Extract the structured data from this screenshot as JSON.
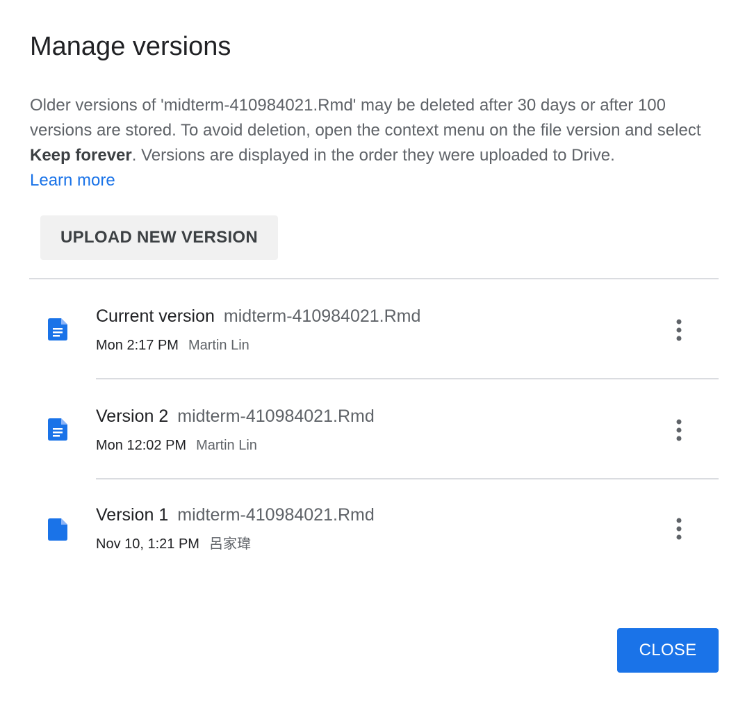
{
  "dialog": {
    "title": "Manage versions",
    "description": {
      "part1": "Older versions of 'midterm-410984021.Rmd' may be deleted after 30 days or after 100 versions are stored. To avoid deletion, open the context menu on the file version and select ",
      "bold": "Keep forever",
      "part2": ". Versions are displayed in the order they were uploaded to Drive.",
      "learn_more": "Learn more"
    },
    "upload_button_label": "UPLOAD NEW VERSION",
    "close_button_label": "CLOSE",
    "accent_color": "#1a73e8",
    "versions": [
      {
        "label": "Current version",
        "file_name": "midterm-410984021.Rmd",
        "time": "Mon 2:17 PM",
        "user": "Martin Lin",
        "icon": "doc-lines-icon"
      },
      {
        "label": "Version 2",
        "file_name": "midterm-410984021.Rmd",
        "time": "Mon 12:02 PM",
        "user": "Martin Lin",
        "icon": "doc-lines-icon"
      },
      {
        "label": "Version 1",
        "file_name": "midterm-410984021.Rmd",
        "time": "Nov 10, 1:21 PM",
        "user": "呂家瑋",
        "icon": "doc-plain-icon"
      }
    ]
  }
}
